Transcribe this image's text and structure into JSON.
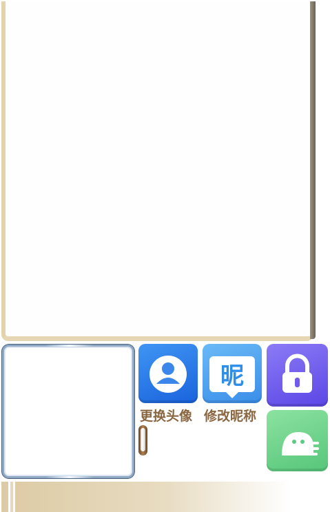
{
  "actions": {
    "change_avatar_label": "更换头像",
    "change_nickname_label": "修改昵称",
    "nickname_icon_glyph": "昵"
  },
  "icons": {
    "change_avatar": "user-avatar-icon",
    "change_nickname": "nickname-icon",
    "lock": "lock-icon",
    "ghost": "ghost-user-icon"
  },
  "colors": {
    "label_text": "#8a6640",
    "tile_avatar": "#2a7aea",
    "tile_nickname": "#4fa3f0",
    "tile_lock": "#6f5cee",
    "tile_ghost": "#6fd28c",
    "panel_border": "#e4d2ac"
  }
}
